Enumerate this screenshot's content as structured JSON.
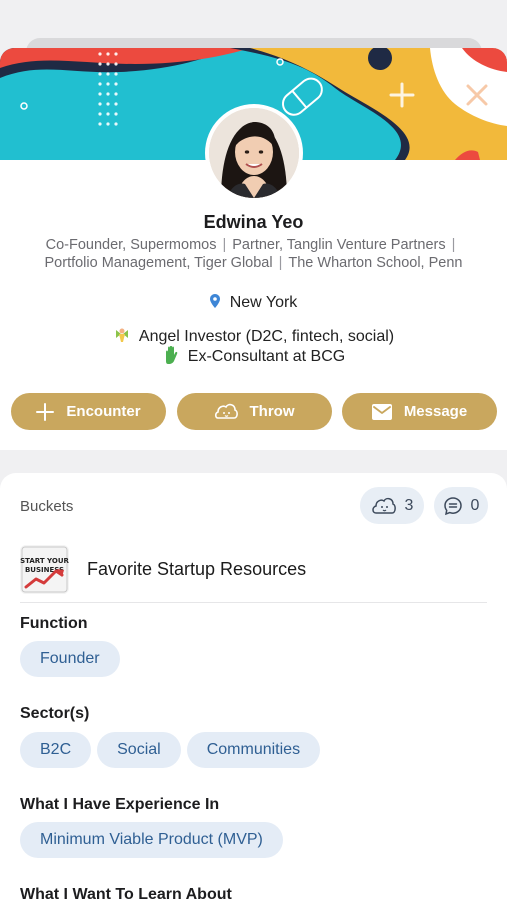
{
  "profile": {
    "name": "Edwina Yeo",
    "headline": [
      [
        "Co-Founder, Supermomos",
        "Partner, Tanglin Venture Partners",
        ""
      ],
      [
        "Portfolio Management, Tiger Global",
        "The Wharton School, Penn"
      ]
    ],
    "headline_line1_a": "Co-Founder, Supermomos",
    "headline_line1_b": "Partner, Tanglin Venture Partners",
    "headline_line2_a": "Portfolio Management, Tiger Global",
    "headline_line2_b": "The Wharton School, Penn",
    "location": "New York",
    "bio_line1": "Angel Investor (D2C, fintech, social)",
    "bio_line2": "Ex-Consultant at BCG",
    "bio_line1_icon": "fairy-emoji",
    "bio_line2_icon": "raised-hand-emoji"
  },
  "actions": {
    "encounter": "Encounter",
    "throw": "Throw",
    "message": "Message"
  },
  "details": {
    "buckets_label": "Buckets",
    "throws_count": "3",
    "comments_count": "0",
    "bucket_title": "Favorite Startup Resources",
    "bucket_thumb_text": "START YOUR BUSINESS",
    "function_title": "Function",
    "function_chips": [
      "Founder"
    ],
    "sectors_title": "Sector(s)",
    "sector_chips": [
      "B2C",
      "Social",
      "Communities"
    ],
    "experience_title": "What I Have Experience In",
    "experience_chips": [
      "Minimum Viable Product (MVP)"
    ],
    "learn_title": "What I Want To Learn About"
  },
  "colors": {
    "accent_gold": "#c9a75e",
    "chip_bg": "#e4ecf6",
    "chip_text": "#2f5f93",
    "banner_teal": "#21bfd0",
    "banner_yellow": "#f2b93b",
    "banner_red": "#ec4a3f",
    "banner_navy": "#1f2a44"
  }
}
